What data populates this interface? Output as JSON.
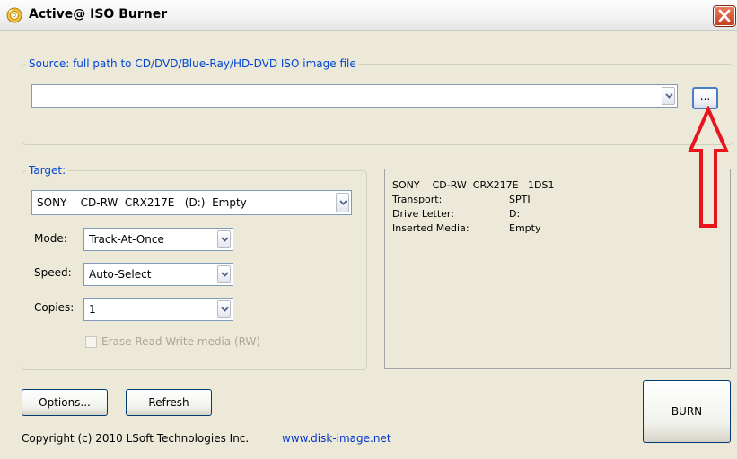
{
  "window": {
    "title": "Active@ ISO Burner",
    "close_label": "X"
  },
  "source": {
    "legend": "Source: full path to CD/DVD/Blue-Ray/HD-DVD ISO image file",
    "path_value": "",
    "browse_label": "..."
  },
  "target": {
    "legend": "Target:",
    "drive": "SONY    CD-RW  CRX217E   (D:)  Empty",
    "mode_label": "Mode:",
    "mode_value": "Track-At-Once",
    "speed_label": "Speed:",
    "speed_value": "Auto-Select",
    "copies_label": "Copies:",
    "copies_value": "1",
    "erase_label": "Erase Read-Write media (RW)",
    "erase_checked": false
  },
  "drive_info": {
    "header": "SONY    CD-RW  CRX217E   1DS1",
    "rows": [
      {
        "key": "Transport:",
        "value": "SPTI"
      },
      {
        "key": "Drive Letter:",
        "value": "D:"
      },
      {
        "key": "Inserted Media:",
        "value": "Empty"
      }
    ]
  },
  "buttons": {
    "options": "Options...",
    "refresh": "Refresh",
    "burn": "BURN"
  },
  "footer": {
    "copyright": "Copyright (c) 2010 LSoft Technologies Inc.",
    "link": "www.disk-image.net"
  },
  "colors": {
    "legend": "#0046d5",
    "link": "#0033cc",
    "annotation_arrow": "#e8141e"
  }
}
